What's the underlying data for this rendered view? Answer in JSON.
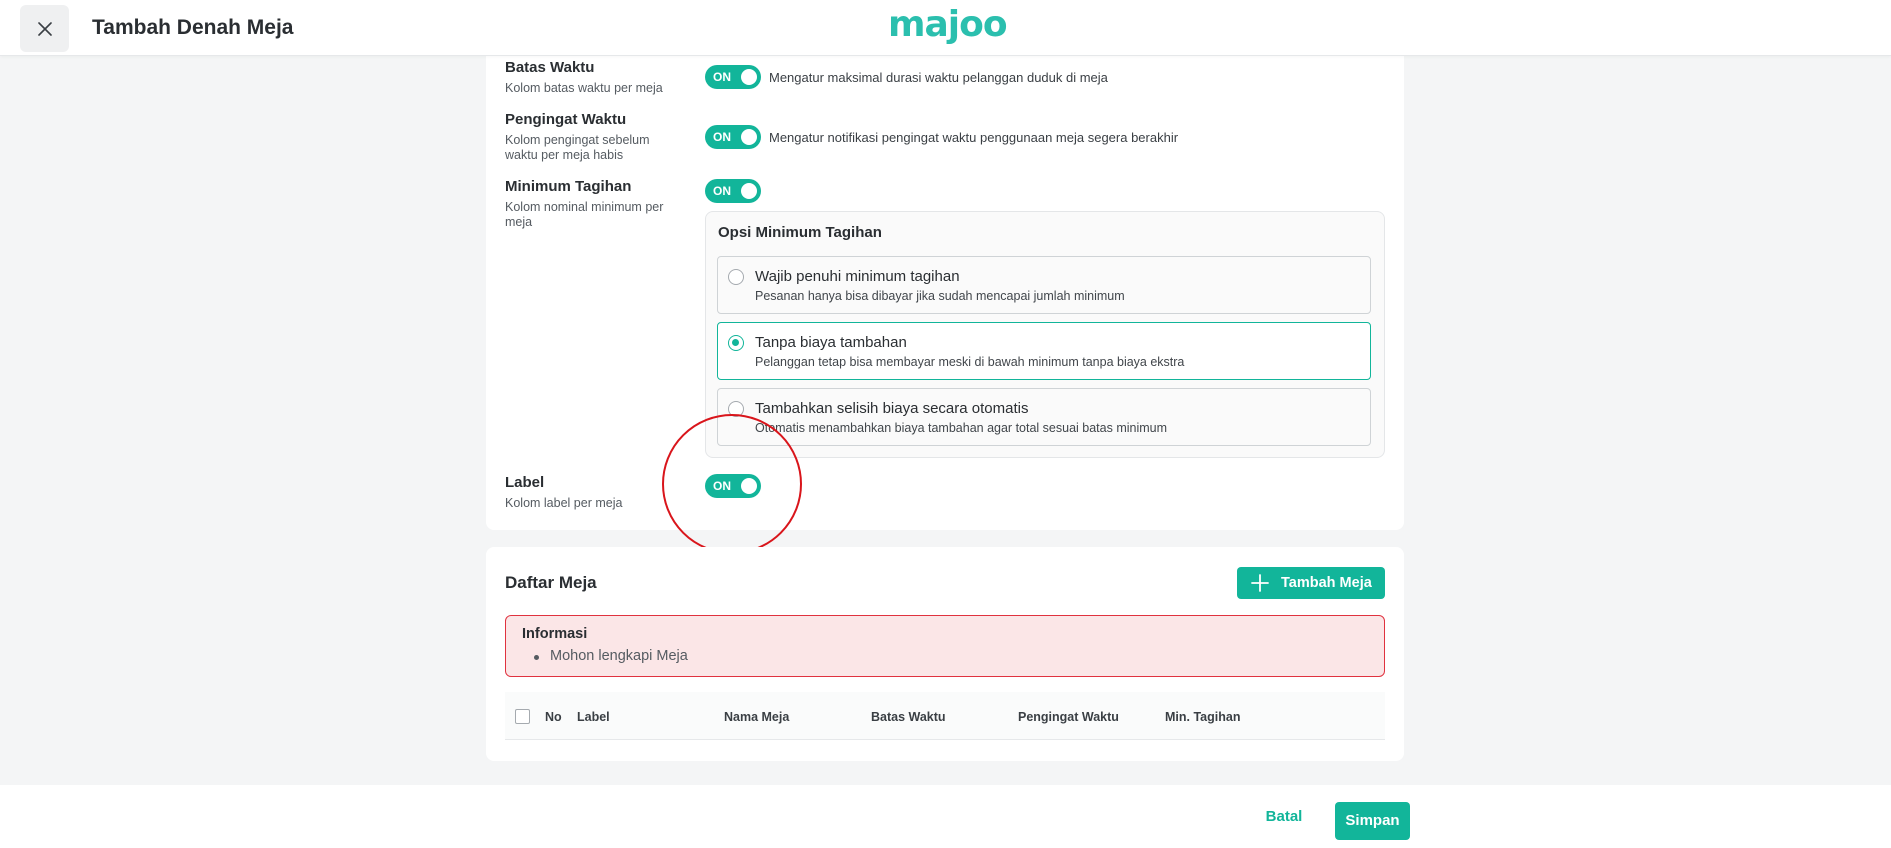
{
  "header": {
    "title": "Tambah Denah Meja",
    "logo_text": "majoo"
  },
  "settings": [
    {
      "title": "Batas Waktu",
      "desc": "Kolom batas waktu per meja",
      "toggle": "ON",
      "hint": "Mengatur maksimal durasi waktu pelanggan duduk di meja"
    },
    {
      "title": "Pengingat Waktu",
      "desc": "Kolom pengingat sebelum waktu per meja habis",
      "toggle": "ON",
      "hint": "Mengatur notifikasi pengingat waktu penggunaan meja segera berakhir"
    },
    {
      "title": "Minimum Tagihan",
      "desc": "Kolom nominal minimum per meja",
      "toggle": "ON"
    },
    {
      "title": "Label",
      "desc": "Kolom label per meja",
      "toggle": "ON"
    }
  ],
  "min_bill_options": {
    "title": "Opsi Minimum Tagihan",
    "selected": "Tanpa biaya tambahan",
    "options": [
      {
        "title": "Wajib penuhi minimum tagihan",
        "desc": "Pesanan hanya bisa dibayar jika sudah mencapai jumlah minimum"
      },
      {
        "title": "Tanpa biaya tambahan",
        "desc": "Pelanggan tetap bisa membayar meski di bawah minimum tanpa biaya ekstra"
      },
      {
        "title": "Tambahkan selisih biaya secara otomatis",
        "desc": "Otomatis menambahkan biaya tambahan agar total sesuai batas minimum"
      }
    ]
  },
  "tables": {
    "title": "Daftar Meja",
    "add_button": "Tambah Meja",
    "info_title": "Informasi",
    "info_items": [
      "Mohon lengkapi Meja"
    ],
    "columns": [
      "No",
      "Label",
      "Nama Meja",
      "Batas Waktu",
      "Pengingat Waktu",
      "Min. Tagihan"
    ]
  },
  "footer": {
    "cancel": "Batal",
    "save": "Simpan"
  },
  "colors": {
    "accent": "#12b59a",
    "error_border": "#e0323f",
    "error_bg": "#fbe6e7",
    "annotation": "#d9151b"
  }
}
